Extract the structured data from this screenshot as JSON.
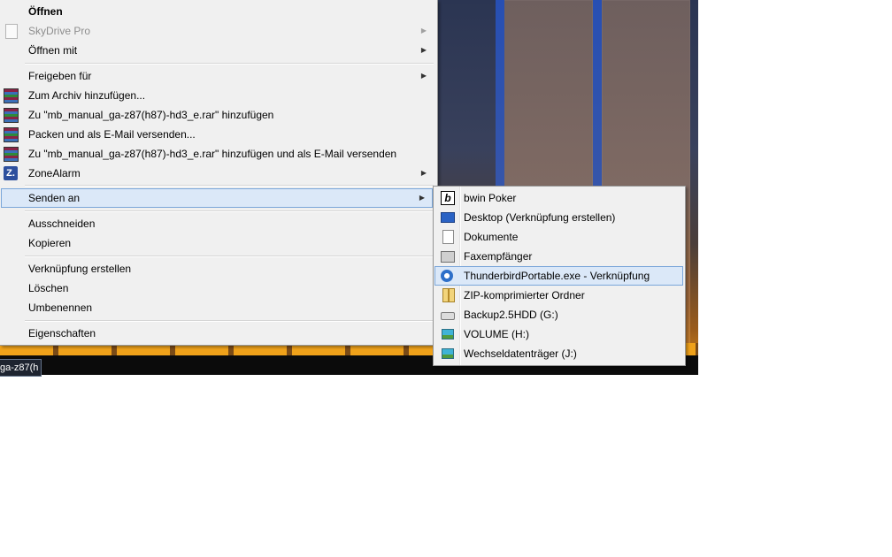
{
  "desktop": {
    "taskbar_label": "ga-z87(h"
  },
  "context_menu": {
    "items": [
      {
        "label": "Öffnen",
        "bold": true
      },
      {
        "label": "SkyDrive Pro",
        "disabled": true,
        "submenu": true
      },
      {
        "label": "Öffnen mit",
        "submenu": true
      },
      {
        "label": "Freigeben für",
        "submenu": true
      },
      {
        "label": "Zum Archiv hinzufügen..."
      },
      {
        "label": "Zu \"mb_manual_ga-z87(h87)-hd3_e.rar\" hinzufügen"
      },
      {
        "label": "Packen und als E-Mail versenden..."
      },
      {
        "label": "Zu \"mb_manual_ga-z87(h87)-hd3_e.rar\" hinzufügen und als E-Mail versenden"
      },
      {
        "label": "ZoneAlarm",
        "submenu": true
      },
      {
        "label": "Senden an",
        "submenu": true,
        "highlighted": true
      },
      {
        "label": "Ausschneiden"
      },
      {
        "label": "Kopieren"
      },
      {
        "label": "Verknüpfung erstellen"
      },
      {
        "label": "Löschen"
      },
      {
        "label": "Umbenennen"
      },
      {
        "label": "Eigenschaften"
      }
    ],
    "submenu_arrow": "▶",
    "zonealarm_icon_text": "Z."
  },
  "send_to_menu": {
    "items": [
      {
        "label": "bwin Poker",
        "icon": "bwin-icon",
        "icon_text": "b"
      },
      {
        "label": "Desktop (Verknüpfung erstellen)",
        "icon": "desktop-icon"
      },
      {
        "label": "Dokumente",
        "icon": "document-icon"
      },
      {
        "label": "Faxempfänger",
        "icon": "fax-icon"
      },
      {
        "label": "ThunderbirdPortable.exe - Verknüpfung",
        "icon": "thunderbird-icon",
        "highlighted": true
      },
      {
        "label": "ZIP-komprimierter Ordner",
        "icon": "zip-folder-icon"
      },
      {
        "label": "Backup2.5HDD (G:)",
        "icon": "hard-drive-icon"
      },
      {
        "label": "VOLUME (H:)",
        "icon": "removable-drive-icon"
      },
      {
        "label": "Wechseldatenträger (J:)",
        "icon": "removable-drive-icon"
      }
    ]
  },
  "colors": {
    "menu_background": "#f0f0f0",
    "highlight_background": "#dbe8f8",
    "highlight_border": "#7aa6d9",
    "disabled_text": "#8d8d8d"
  }
}
